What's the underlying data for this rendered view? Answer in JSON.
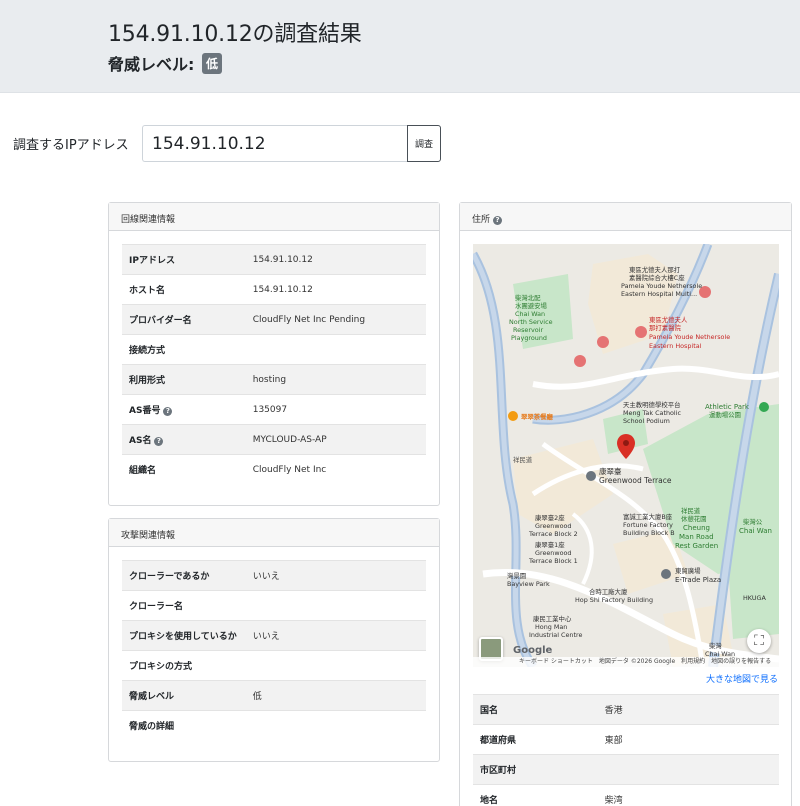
{
  "header": {
    "title": "154.91.10.12の調査結果",
    "threat_label": "脅威レベル:",
    "threat_badge": "低"
  },
  "search": {
    "label": "調査するIPアドレス",
    "value": "154.91.10.12",
    "button_label": "調査"
  },
  "line_info": {
    "heading": "回線関連情報",
    "rows": [
      {
        "key": "IPアドレス",
        "value": "154.91.10.12",
        "help": false
      },
      {
        "key": "ホスト名",
        "value": "154.91.10.12",
        "help": false
      },
      {
        "key": "プロバイダー名",
        "value": "CloudFly Net Inc Pending",
        "help": false
      },
      {
        "key": "接続方式",
        "value": "",
        "help": false
      },
      {
        "key": "利用形式",
        "value": "hosting",
        "help": false
      },
      {
        "key": "AS番号",
        "value": "135097",
        "help": true
      },
      {
        "key": "AS名",
        "value": "MYCLOUD-AS-AP",
        "help": true
      },
      {
        "key": "組織名",
        "value": "CloudFly Net Inc",
        "help": false
      }
    ]
  },
  "attack_info": {
    "heading": "攻撃関連情報",
    "rows": [
      {
        "key": "クローラーであるか",
        "value": "いいえ"
      },
      {
        "key": "クローラー名",
        "value": ""
      },
      {
        "key": "プロキシを使用しているか",
        "value": "いいえ"
      },
      {
        "key": "プロキシの方式",
        "value": ""
      },
      {
        "key": "脅威レベル",
        "value": "低"
      },
      {
        "key": "脅威の詳細",
        "value": ""
      }
    ]
  },
  "address": {
    "heading": "住所",
    "map_link": "大きな地図で見る",
    "map": {
      "labels": [
        {
          "text": "東區尤德夫人那打",
          "cls": "dark"
        },
        {
          "text": "素醫院綜合大樓C座",
          "cls": "dark"
        },
        {
          "text": "Pamela Youde Nethersole",
          "cls": "dark"
        },
        {
          "text": "Eastern Hospital Multi...",
          "cls": "dark"
        },
        {
          "text": "柴灣北配",
          "cls": "green"
        },
        {
          "text": "水團避安場",
          "cls": "green"
        },
        {
          "text": "Chai Wan",
          "cls": "green"
        },
        {
          "text": "North Service",
          "cls": "green"
        },
        {
          "text": "Reservoir",
          "cls": "green"
        },
        {
          "text": "Playground",
          "cls": "green"
        },
        {
          "text": "東區尤德夫人",
          "cls": "red"
        },
        {
          "text": "那打素醫院",
          "cls": "red"
        },
        {
          "text": "Pamela Youde Nethersole",
          "cls": "red"
        },
        {
          "text": "Eastern Hospital",
          "cls": "red"
        },
        {
          "text": "翠翠茶餐廳",
          "cls": "orange"
        },
        {
          "text": "天主教明德學校平台",
          "cls": "dark"
        },
        {
          "text": "Meng Tak Catholic",
          "cls": "dark"
        },
        {
          "text": "School Podium",
          "cls": "dark"
        },
        {
          "text": "康翠臺",
          "cls": "dark"
        },
        {
          "text": "Greenwood Terrace",
          "cls": "dark"
        },
        {
          "text": "Athletic Park",
          "cls": "green"
        },
        {
          "text": "運動場公園",
          "cls": "green"
        },
        {
          "text": "祥民道",
          "cls": "road"
        },
        {
          "text": "富誠工業大廈B座",
          "cls": "dark"
        },
        {
          "text": "Fortune Factory",
          "cls": "dark"
        },
        {
          "text": "Building Block B",
          "cls": "dark"
        },
        {
          "text": "祥民道",
          "cls": "green"
        },
        {
          "text": "休憩花園",
          "cls": "green"
        },
        {
          "text": "Cheung",
          "cls": "green"
        },
        {
          "text": "Man Road",
          "cls": "green"
        },
        {
          "text": "Rest Garden",
          "cls": "green"
        },
        {
          "text": "柴灣公",
          "cls": "green"
        },
        {
          "text": "Chai Wan",
          "cls": "green"
        },
        {
          "text": "康翠臺2座",
          "cls": "dark"
        },
        {
          "text": "Greenwood",
          "cls": "dark"
        },
        {
          "text": "Terrace Block 2",
          "cls": "dark"
        },
        {
          "text": "康翠臺1座",
          "cls": "dark"
        },
        {
          "text": "Greenwood",
          "cls": "dark"
        },
        {
          "text": "Terrace Block 1",
          "cls": "dark"
        },
        {
          "text": "東貿廣場",
          "cls": "dark"
        },
        {
          "text": "E-Trade Plaza",
          "cls": "dark"
        },
        {
          "text": "HKUGA",
          "cls": "dark"
        },
        {
          "text": "灣景園",
          "cls": "dark"
        },
        {
          "text": "Bayview Park",
          "cls": "dark"
        },
        {
          "text": "合時工廠大廈",
          "cls": "dark"
        },
        {
          "text": "Hop Shi Factory Building",
          "cls": "dark"
        },
        {
          "text": "康民工業中心",
          "cls": "dark"
        },
        {
          "text": "Hong Man",
          "cls": "dark"
        },
        {
          "text": "Industrial Centre",
          "cls": "dark"
        },
        {
          "text": "柴灣",
          "cls": "dark"
        },
        {
          "text": "Chai Wan",
          "cls": "dark"
        }
      ],
      "attribution": "キーボード ショートカット　地図データ ©2026 Google　利用規約　地図の誤りを報告する",
      "google_logo": "Google"
    },
    "rows": [
      {
        "key": "国名",
        "value": "香港"
      },
      {
        "key": "都道府県",
        "value": "東部"
      },
      {
        "key": "市区町村",
        "value": ""
      },
      {
        "key": "地名",
        "value": "柴湾"
      }
    ]
  },
  "colors": {
    "header_bg": "#e9ecef",
    "badge_bg": "#6c757d",
    "link": "#0d6efd",
    "map_park": "#c8e6c9",
    "map_water_road": "#a9c2df",
    "map_pin": "#d93025"
  }
}
